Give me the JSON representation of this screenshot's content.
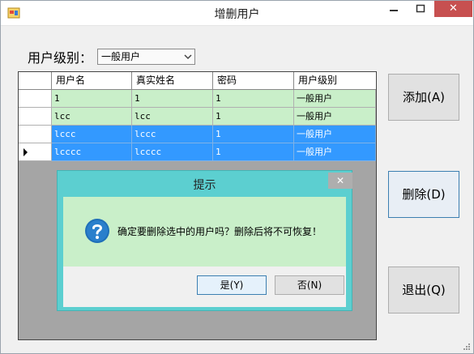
{
  "window": {
    "title": "增删用户"
  },
  "titlebar_buttons": {
    "minimize": "–",
    "maximize": "□",
    "close": "✕"
  },
  "filter": {
    "label": "用户级别：",
    "selected": "一般用户"
  },
  "grid": {
    "columns": [
      "用户名",
      "真实姓名",
      "密码",
      "用户级别"
    ],
    "rows": [
      {
        "cells": [
          "1",
          "1",
          "1",
          "一般用户"
        ],
        "selected": false
      },
      {
        "cells": [
          "lcc",
          "lcc",
          "1",
          "一般用户"
        ],
        "selected": false
      },
      {
        "cells": [
          "lccc",
          "lccc",
          "1",
          "一般用户"
        ],
        "selected": true
      },
      {
        "cells": [
          "lcccc",
          "lcccc",
          "1",
          "一般用户"
        ],
        "selected": true
      }
    ]
  },
  "buttons": {
    "add": "添加(A)",
    "delete": "删除(D)",
    "exit": "退出(Q)"
  },
  "dialog": {
    "title": "提示",
    "close": "✕",
    "message": "确定要删除选中的用户吗？删除后将不可恢复！",
    "yes": "是(Y)",
    "no": "否(N)"
  },
  "colors": {
    "row_normal": "#c9efc9",
    "row_selected": "#3399ff",
    "dialog_frame": "#5ccfd0",
    "question_icon": "#1f6fb8"
  }
}
